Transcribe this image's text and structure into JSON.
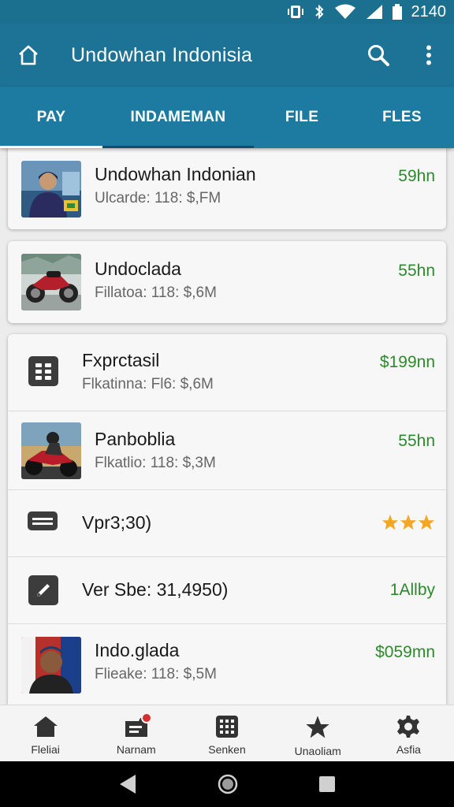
{
  "status_bar": {
    "time": "2140"
  },
  "app_bar": {
    "title": "Undowhan Indonisia"
  },
  "tabs": [
    {
      "label": "PAY"
    },
    {
      "label": "INDAMEMAN"
    },
    {
      "label": "FILE"
    },
    {
      "label": "FLES"
    }
  ],
  "cards": [
    {
      "rows": [
        {
          "title": "Undowhan Indonian",
          "subtitle": "Ulcarde: 118: $,FM",
          "value": "59hn",
          "thumb": "person-photo"
        }
      ]
    },
    {
      "rows": [
        {
          "title": "Undoclada",
          "subtitle": "Fillatoa: 118: $,6M",
          "value": "55hn",
          "thumb": "motorcycle-photo"
        }
      ]
    },
    {
      "rows": [
        {
          "title": "Fxprctasil",
          "subtitle": "Flkatinna: Fl6: $,6M",
          "value": "$199nn",
          "icon": "grid-icon"
        },
        {
          "title": "Panboblia",
          "subtitle": "Flkatlio: 118: $,3M",
          "value": "55hn",
          "thumb": "rider-photo"
        },
        {
          "title": "Vpr3;30)",
          "rating": 3,
          "icon": "message-icon"
        },
        {
          "title": "Ver Sbe: 31,4950)",
          "value": "1Allby",
          "icon": "edit-icon"
        },
        {
          "title": "Indo.glada",
          "subtitle": "Flieake: 118:  $,5M",
          "value": "$059mn",
          "thumb": "portrait-photo"
        }
      ]
    }
  ],
  "bottom_nav": [
    {
      "label": "Fleliai",
      "icon": "home-icon"
    },
    {
      "label": "Narnam",
      "icon": "wallet-icon",
      "badge": true
    },
    {
      "label": "Senken",
      "icon": "apps-icon"
    },
    {
      "label": "Unaoliam",
      "icon": "star-icon"
    },
    {
      "label": "Asfia",
      "icon": "settings-icon"
    }
  ],
  "colors": {
    "primary": "#1c7396",
    "tab_bar": "#1d7aa0",
    "value_green": "#2c8a2c",
    "star": "#f5a623"
  }
}
